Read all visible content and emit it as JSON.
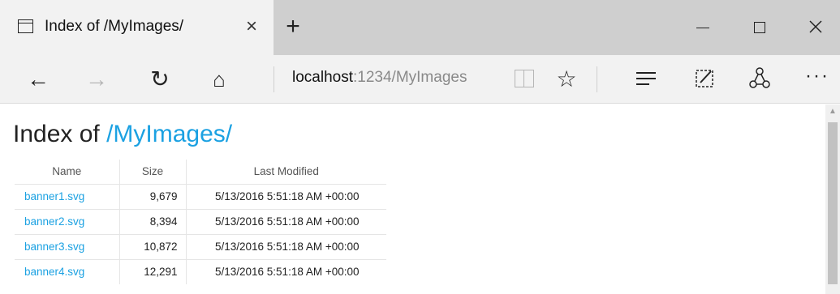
{
  "tab": {
    "title": "Index of /MyImages/",
    "close": "×"
  },
  "window": {
    "new_tab": "+"
  },
  "nav": {
    "back": "←",
    "forward": "→",
    "refresh": "↻",
    "home": "⌂",
    "address_host": "localhost",
    "address_rest": ":1234/MyImages",
    "favorite": "☆",
    "more": "···"
  },
  "page": {
    "heading_prefix": "Index of ",
    "heading_path": "/MyImages/",
    "columns": {
      "name": "Name",
      "size": "Size",
      "modified": "Last Modified"
    },
    "files": [
      {
        "name": "banner1.svg",
        "size": "9,679",
        "modified": "5/13/2016 5:51:18 AM +00:00"
      },
      {
        "name": "banner2.svg",
        "size": "8,394",
        "modified": "5/13/2016 5:51:18 AM +00:00"
      },
      {
        "name": "banner3.svg",
        "size": "10,872",
        "modified": "5/13/2016 5:51:18 AM +00:00"
      },
      {
        "name": "banner4.svg",
        "size": "12,291",
        "modified": "5/13/2016 5:51:18 AM +00:00"
      }
    ]
  },
  "colors": {
    "link": "#1ba1e2",
    "tabbar": "#cfcfcf",
    "toolbar": "#f2f2f2"
  },
  "icons": {
    "tab": "tab-page-icon",
    "reading": "reading-view-icon",
    "hub": "hub-icon",
    "note": "web-note-icon",
    "share": "share-icon"
  }
}
